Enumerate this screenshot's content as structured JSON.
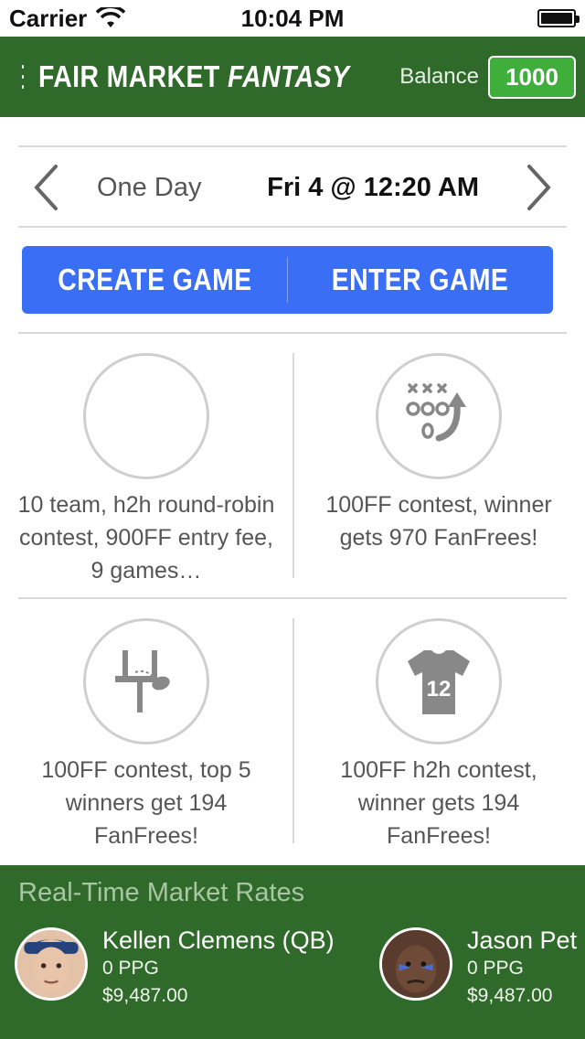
{
  "status_bar": {
    "carrier": "Carrier",
    "time": "10:04 PM"
  },
  "header": {
    "title_main": "FAIR MARKET",
    "title_accent": "FANTASY",
    "balance_label": "Balance",
    "balance_value": "1000"
  },
  "date_selector": {
    "period": "One Day",
    "datetime": "Fri 4 @ 12:20 AM"
  },
  "actions": {
    "create": "CREATE GAME",
    "enter": "ENTER GAME"
  },
  "contests": [
    {
      "icon": "empty-icon",
      "description": "10 team, h2h round-robin contest, 900FF entry fee, 9 games…"
    },
    {
      "icon": "playbook-icon",
      "description": "100FF contest, winner gets 970 FanFrees!"
    },
    {
      "icon": "goalpost-icon",
      "description": "100FF contest, top 5 winners get 194 FanFrees!"
    },
    {
      "icon": "jersey-icon",
      "description": "100FF h2h contest, winner gets 194 FanFrees!"
    }
  ],
  "market": {
    "title": "Real-Time Market Rates",
    "players": [
      {
        "name": "Kellen Clemens (QB)",
        "ppg": "0 PPG",
        "price": "$9,487.00"
      },
      {
        "name": "Jason Pet",
        "ppg": "0 PPG",
        "price": "$9,487.00"
      }
    ]
  },
  "colors": {
    "header_green": "#2f6a2a",
    "balance_green": "#3fae3a",
    "button_blue": "#3a6ef5"
  }
}
